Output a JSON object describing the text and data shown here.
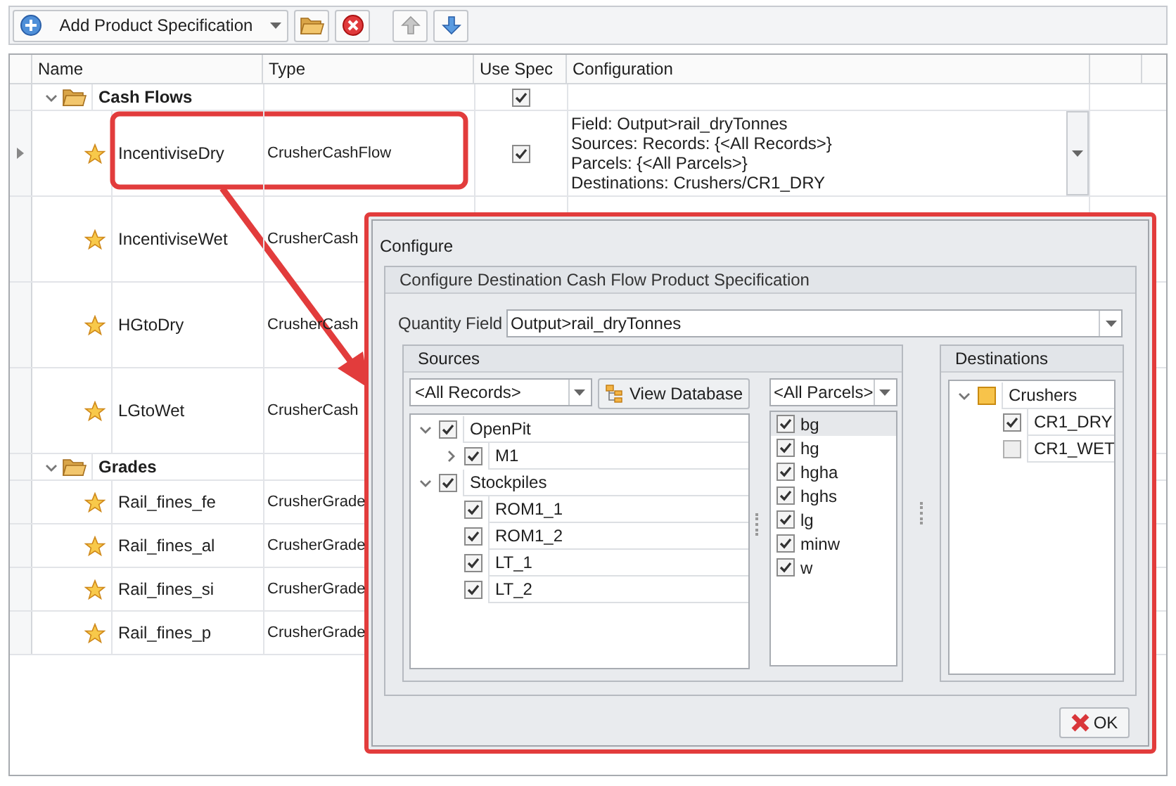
{
  "toolbar": {
    "add_button": "Add Product Specification",
    "move_up": {
      "disabled": true
    },
    "move_down": {
      "disabled": false
    }
  },
  "table": {
    "columns": [
      "Name",
      "Type",
      "Use Spec",
      "Configuration"
    ],
    "groups": [
      {
        "name": "Cash Flows",
        "expanded": true,
        "use_spec": true,
        "rows": [
          {
            "name": "IncentiviseDry",
            "type": "CrusherCashFlow",
            "focused": true,
            "use_spec": true,
            "configuration": [
              "Field: Output>rail_dryTonnes",
              "Sources: Records: {<All Records>}",
              "Parcels: {<All Parcels>}",
              "Destinations: Crushers/CR1_DRY"
            ]
          },
          {
            "name": "IncentiviseWet",
            "type": "CrusherCash",
            "focused": false
          },
          {
            "name": "HGtoDry",
            "type": "CrusherCash",
            "focused": false
          },
          {
            "name": "LGtoWet",
            "type": "CrusherCash",
            "focused": false
          }
        ]
      },
      {
        "name": "Grades",
        "expanded": true,
        "rows": [
          {
            "name": "Rail_fines_fe",
            "type": "CrusherGrade",
            "focused": false
          },
          {
            "name": "Rail_fines_al",
            "type": "CrusherGrade",
            "focused": false
          },
          {
            "name": "Rail_fines_si",
            "type": "CrusherGrade",
            "focused": false
          },
          {
            "name": "Rail_fines_p",
            "type": "CrusherGrade",
            "focused": false
          }
        ]
      }
    ]
  },
  "dialog": {
    "title": "Configure",
    "group_title": "Configure Destination Cash Flow Product Specification",
    "quantity_field": {
      "label": "Quantity Field",
      "value": "Output>rail_dryTonnes"
    },
    "sources": {
      "title": "Sources",
      "records": "<All Records>",
      "view_database_button": "View Database",
      "tree": [
        {
          "label": "OpenPit",
          "checked": true,
          "expanded": true,
          "children": [
            {
              "label": "M1",
              "checked": true,
              "expanded": false
            }
          ]
        },
        {
          "label": "Stockpiles",
          "checked": true,
          "expanded": true,
          "children": [
            {
              "label": "ROM1_1",
              "checked": true
            },
            {
              "label": "ROM1_2",
              "checked": true
            },
            {
              "label": "LT_1",
              "checked": true
            },
            {
              "label": "LT_2",
              "checked": true
            }
          ]
        }
      ]
    },
    "parcels": {
      "filter": "<All Parcels>",
      "items": [
        {
          "label": "bg",
          "checked": true,
          "selected": true
        },
        {
          "label": "hg",
          "checked": true,
          "selected": false
        },
        {
          "label": "hgha",
          "checked": true,
          "selected": false
        },
        {
          "label": "hghs",
          "checked": true,
          "selected": false
        },
        {
          "label": "lg",
          "checked": true,
          "selected": false
        },
        {
          "label": "minw",
          "checked": true,
          "selected": false
        },
        {
          "label": "w",
          "checked": true,
          "selected": false
        }
      ]
    },
    "destinations": {
      "title": "Destinations",
      "tree": [
        {
          "label": "Crushers",
          "expanded": true,
          "children": [
            {
              "label": "CR1_DRY",
              "checked": true
            },
            {
              "label": "CR1_WET",
              "checked": false
            }
          ]
        }
      ]
    },
    "ok_button": "OK"
  }
}
